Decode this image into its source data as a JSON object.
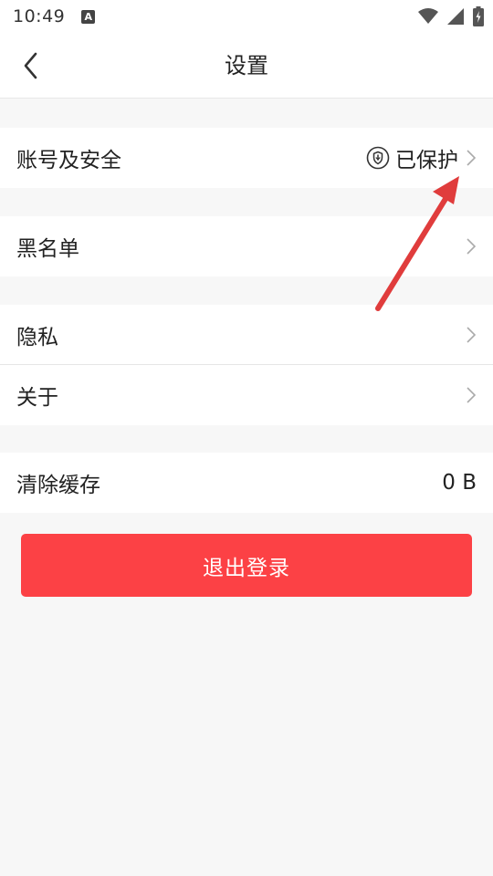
{
  "status": {
    "time": "10:49",
    "notif_letter": "A"
  },
  "header": {
    "title": "设置",
    "back_icon": "chevron-left-icon"
  },
  "settings": {
    "account_label": "账号及安全",
    "account_status": "已保护",
    "blacklist_label": "黑名单",
    "privacy_label": "隐私",
    "about_label": "关于",
    "cache_label": "清除缓存",
    "cache_value": "0 B"
  },
  "actions": {
    "logout_label": "退出登录"
  },
  "colors": {
    "accent": "#fc4145",
    "arrow": "#e03c3c",
    "background": "#f7f7f7"
  }
}
